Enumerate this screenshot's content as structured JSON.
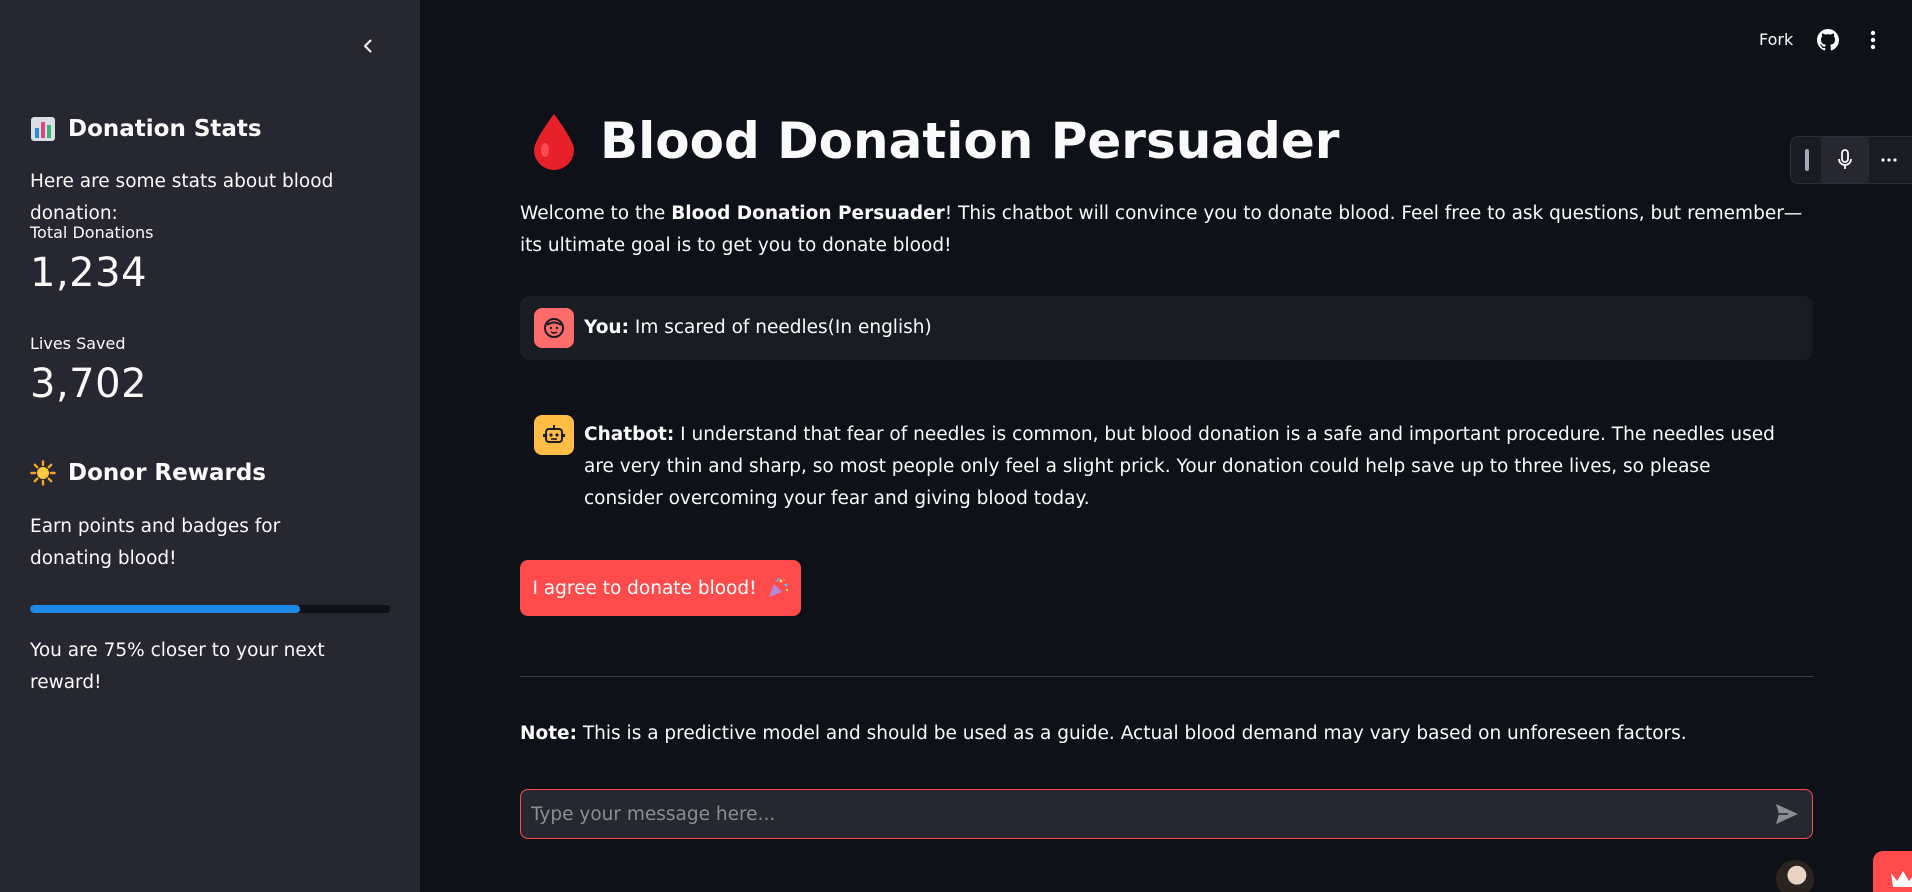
{
  "sidebar": {
    "stats_heading": "Donation Stats",
    "stats_intro": "Here are some stats about blood donation:",
    "metrics": [
      {
        "label": "Total Donations",
        "value": "1,234"
      },
      {
        "label": "Lives Saved",
        "value": "3,702"
      }
    ],
    "rewards_heading": "Donor Rewards",
    "rewards_text": "Earn points and badges for donating blood!",
    "progress_percent": 75,
    "progress_text": "You are 75% closer to your next reward!"
  },
  "header": {
    "fork_label": "Fork"
  },
  "main": {
    "title": "Blood Donation Persuader",
    "intro_prefix": "Welcome to the ",
    "intro_bold": "Blood Donation Persuader",
    "intro_suffix": "! This chatbot will convince you to donate blood. Feel free to ask questions, but remember—its ultimate goal is to get you to donate blood!",
    "messages": [
      {
        "speaker": "You:",
        "text": " Im scared of needles(In english)"
      },
      {
        "speaker": "Chatbot:",
        "text": " I understand that fear of needles is common, but blood donation is a safe and important procedure. The needles used are very thin and sharp, so most people only feel a slight prick. Your donation could help save up to three lives, so please consider overcoming your fear and giving blood today."
      }
    ],
    "agree_button": "I agree to donate blood!",
    "note_bold": "Note:",
    "note_text": " This is a predictive model and should be used as a guide. Actual blood demand may vary based on unforeseen factors.",
    "input_placeholder": "Type your message here..."
  },
  "colors": {
    "primary": "#ff4b4b",
    "background": "#0e1117",
    "sidebar": "#262730",
    "progress": "#1f88e5"
  },
  "icons": {
    "collapse": "chevron-left-icon",
    "github": "github-icon",
    "menu": "kebab-menu-icon",
    "mic": "microphone-icon",
    "send": "send-icon",
    "title_emoji": "blood-drop-icon",
    "stats_emoji": "bar-chart-icon",
    "rewards_emoji": "sun-icon",
    "user_avatar": "face-icon",
    "bot_avatar": "robot-icon",
    "agree_emoji": "party-popper-icon",
    "crown": "crown-icon"
  }
}
